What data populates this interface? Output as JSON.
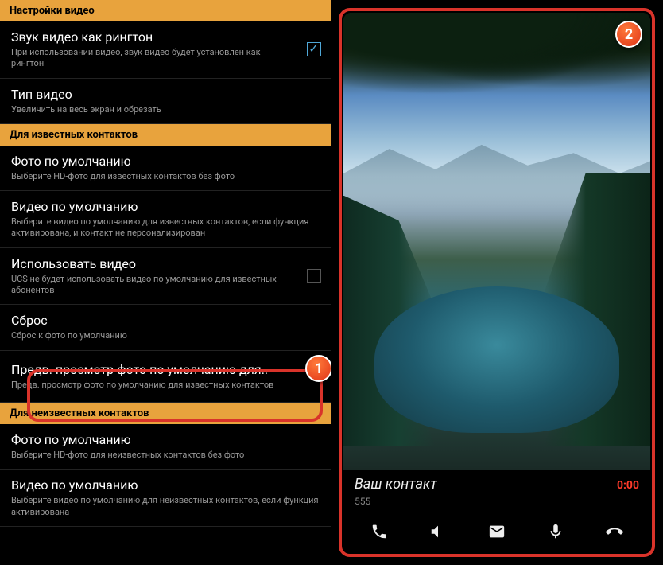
{
  "badges": {
    "one": "1",
    "two": "2"
  },
  "sections": {
    "video": {
      "header": "Настройки видео",
      "ringtone": {
        "title": "Звук видео как рингтон",
        "desc": "При использовании видео, звук видео будет установлен как рингтон"
      },
      "type": {
        "title": "Тип видео",
        "desc": "Увеличить на весь экран и обрезать"
      }
    },
    "known": {
      "header": "Для известных контактов",
      "photo": {
        "title": "Фото по умолчанию",
        "desc": "Выберите HD-фото для известных контактов без фото"
      },
      "video": {
        "title": "Видео по умолчанию",
        "desc": "Выберите видео по умолчанию для известных контактов, если функция активирована, и контакт не персонализирован"
      },
      "usevideo": {
        "title": "Использовать видео",
        "desc": "UCS не будет использовать видео по умолчанию для известных абонентов"
      },
      "reset": {
        "title": "Сброс",
        "desc": "Сброс к фото по умолчанию"
      },
      "preview": {
        "title": "Предв. просмотр фото по умолчанию для..",
        "desc": "Предв. просмотр фото по умолчанию для известных контактов"
      }
    },
    "unknown": {
      "header": "Для неизвестных контактов",
      "photo": {
        "title": "Фото по умолчанию",
        "desc": "Выберите HD-фото для неизвестных контактов без фото"
      },
      "video": {
        "title": "Видео по умолчанию",
        "desc": "Выберите видео по умолчанию для неизвестных контактов, если функция активирована"
      }
    }
  },
  "preview": {
    "contact_name": "Ваш контакт",
    "time": "0:00",
    "number": "555"
  }
}
